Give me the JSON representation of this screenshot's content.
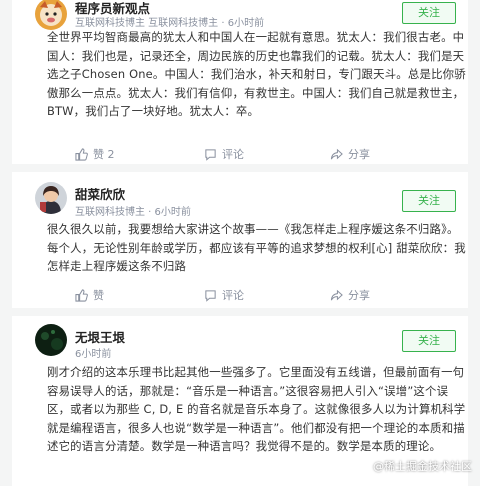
{
  "posts": [
    {
      "author": "程序员新观点",
      "meta": "互联网科技博主 互联网科技博主 · 6小时前",
      "follow_label": "关注",
      "text": "全世界平均智商最高的犹太人和中国人在一起就有意思。犹太人：我们很古老。中国人：我们也是，记录还全，周边民族的历史也靠我们的记载。犹太人：我们是天选之子Chosen One。中国人：我们治水，补天和射日，专门跟天斗。总是比你骄傲那么一点点。犹太人：我们有信仰，有救世主。中国人：我们自己就是救世主，BTW，我们占了一块好地。犹太人：卒。",
      "likes": "赞 2",
      "comments": "评论",
      "share": "分享"
    },
    {
      "author": "甜菜欣欣",
      "meta": "互联网科技博主 · 6小时前",
      "follow_label": "关注",
      "text_prefix": "很久很久以前，我要想给大家讲这个故事——《我怎样走上程序媛这条不归路》。每个人，无论性别年龄或学历，都应该有平等的追求梦想的权利[心] ",
      "text_mention": "甜菜欣欣",
      "text_suffix": "：我怎样走上程序媛这条不归路",
      "likes": "赞",
      "comments": "评论",
      "share": "分享"
    },
    {
      "author": "无垠王垠",
      "meta": "6小时前",
      "follow_label": "关注",
      "text": "刚才介绍的这本乐理书比起其他一些强多了。它里面没有五线谱，但最前面有一句容易误导人的话，那就是：“音乐是一种语言。”这很容易把人引入“误增”这个误区，或者以为那些 C, D, E 的音名就是音乐本身了。这就像很多人以为计算机科学就是编程语言，很多人也说“数学是一种语言”。他们都没有把一个理论的本质和描述它的语言分清楚。数学是一种语言吗？我觉得不是的。数学是本质的理论。"
    }
  ],
  "watermark": "@稀土掘金技术社区",
  "colors": {
    "accent": "#37b24d",
    "link": "#1e80ff",
    "muted": "#8a919f"
  },
  "icons": [
    "thumb-up-icon",
    "comment-icon",
    "share-icon"
  ]
}
